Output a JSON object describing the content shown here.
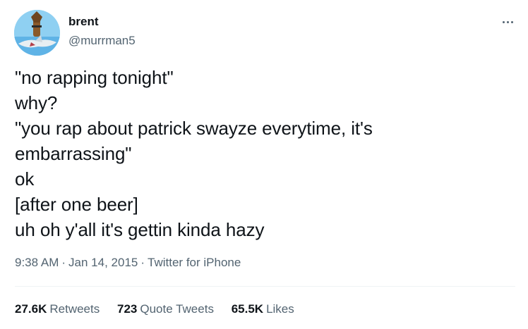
{
  "user": {
    "name": "brent",
    "handle": "@murrman5"
  },
  "tweet": {
    "lines": [
      "\"no rapping tonight\"",
      "why?",
      "\"you rap about patrick swayze everytime, it's",
      "embarrassing\"",
      "ok",
      "[after one beer]",
      "uh oh y'all it's gettin kinda hazy"
    ]
  },
  "meta": {
    "time": "9:38 AM",
    "date": "Jan 14, 2015",
    "source": "Twitter for iPhone",
    "separator": "·"
  },
  "stats": {
    "retweets": {
      "count": "27.6K",
      "label": "Retweets"
    },
    "quotes": {
      "count": "723",
      "label": "Quote Tweets"
    },
    "likes": {
      "count": "65.5K",
      "label": "Likes"
    }
  },
  "icons": {
    "avatar": "avatar-icon",
    "more": "more-options-icon"
  },
  "colors": {
    "text": "#0f1419",
    "secondary": "#536471",
    "divider": "#eff3f4"
  }
}
